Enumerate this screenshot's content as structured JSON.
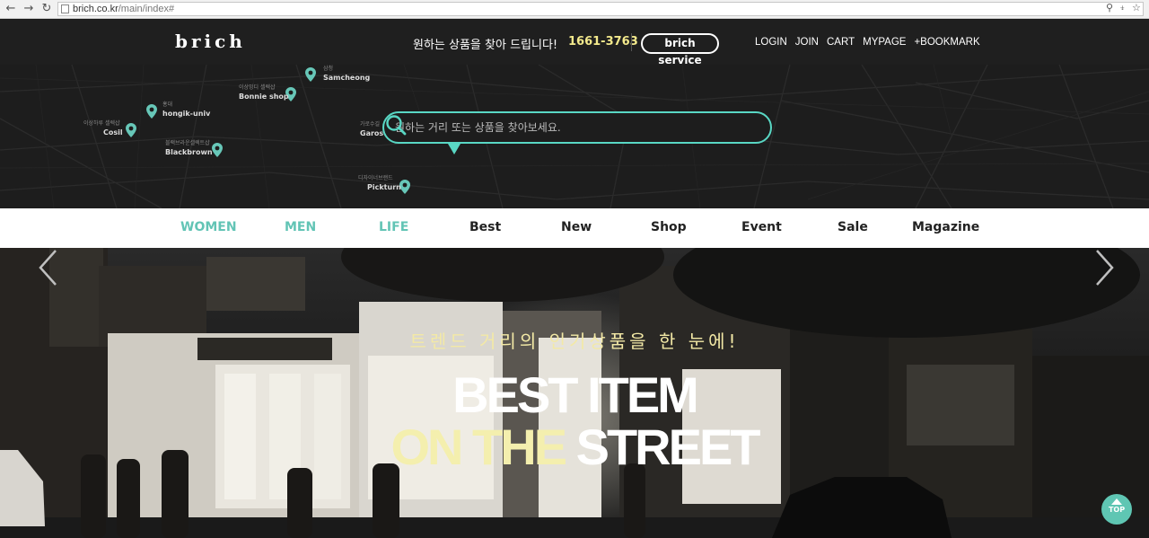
{
  "browser": {
    "url_host": "brich.co.kr",
    "url_path": "/main/index#"
  },
  "header": {
    "logo": "brich",
    "tagline": "원하는 상품을 찾아 드립니다!",
    "phone": "1661-3763",
    "service_button": "brich service",
    "links": [
      "LOGIN",
      "JOIN",
      "CART",
      "MYPAGE",
      "+BOOKMARK"
    ]
  },
  "map": {
    "pins": [
      {
        "label": "Samcheong",
        "kr": "삼청"
      },
      {
        "label": "Bonnie shop",
        "kr": "이상밍디 셀렉샵"
      },
      {
        "label": "hongik-univ",
        "kr": "홍대"
      },
      {
        "label": "Cosil",
        "kr": "이상하루 셀렉샵"
      },
      {
        "label": "Blackbrown",
        "kr": "블랙브라운셀렉트샵"
      },
      {
        "label": "Garosu-Gil",
        "kr": "가로수길"
      },
      {
        "label": "Pickturn",
        "kr": "디자이너브랜드"
      }
    ],
    "accent": "#59d7c4"
  },
  "search": {
    "placeholder": "원하는 거리 또는 상품을 찾아보세요."
  },
  "nav": {
    "items": [
      "WOMEN",
      "MEN",
      "LIFE",
      "Best",
      "New",
      "Shop",
      "Event",
      "Sale",
      "Magazine"
    ],
    "highlight_color": "#62c4b5"
  },
  "banner": {
    "subtitle": "트렌드 거리의  인기상품을 한 눈에!",
    "line1": "BEST ITEM",
    "line2_yellow": "ON THE",
    "line2_white": " STREET",
    "top_button": "TOP"
  }
}
